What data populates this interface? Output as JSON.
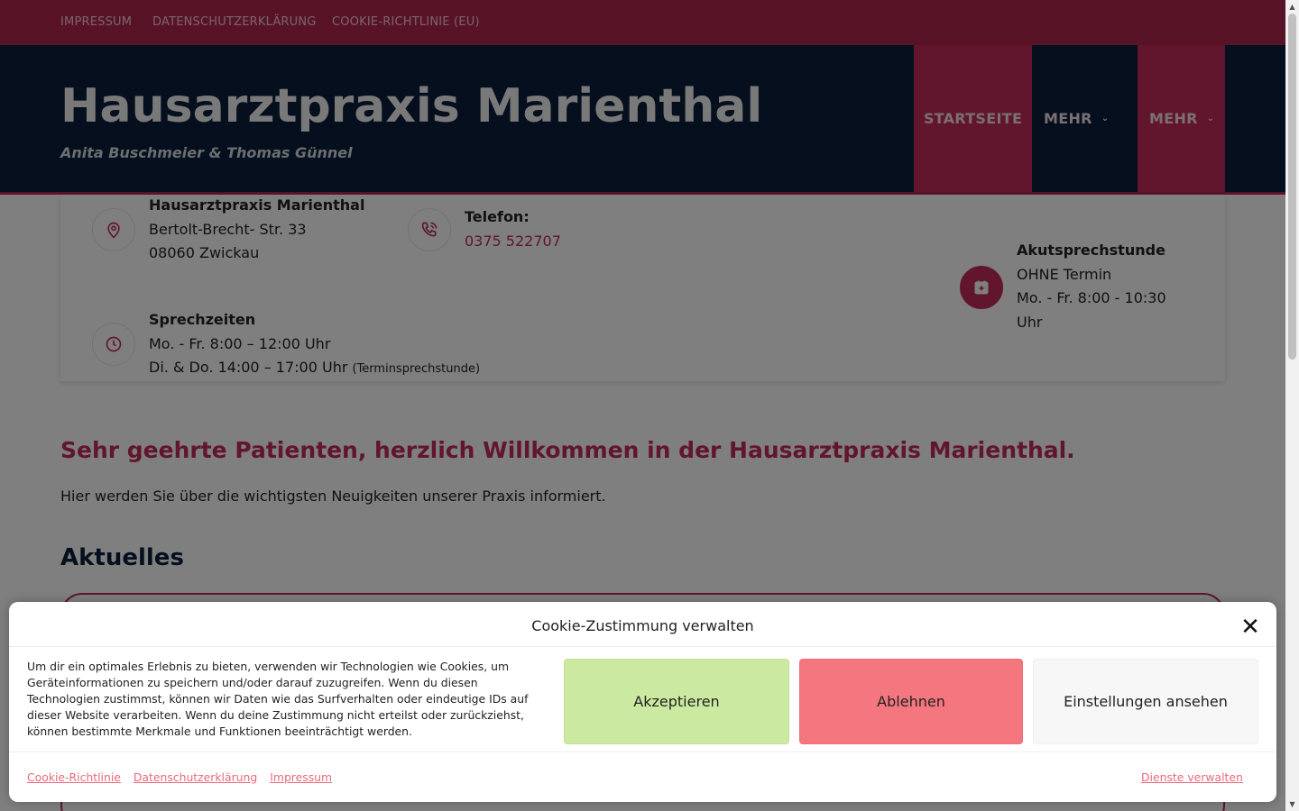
{
  "topbar": {
    "links": [
      "IMPRESSUM",
      "DATENSCHUTZERKLÄRUNG",
      "COOKIE-RICHTLINIE (EU)"
    ]
  },
  "header": {
    "title": "Hausarztpraxis Marienthal",
    "subtitle": "Anita Buschmeier & Thomas Günnel",
    "nav": {
      "home": "STARTSEITE",
      "more1": "MEHR",
      "more2": "MEHR"
    }
  },
  "info": {
    "address": {
      "name": "Hausarztpraxis Marienthal",
      "street": "Bertolt-Brecht- Str. 33",
      "city": "08060 Zwickau",
      "icon": "map-pin-icon"
    },
    "phone": {
      "label": "Telefon:",
      "number": "0375 522707",
      "icon": "phone-icon"
    },
    "hours": {
      "label": "Sprechzeiten",
      "line1": "Mo. - Fr. 8:00 – 12:00 Uhr",
      "line2": "Di. & Do. 14:00 – 17:00 Uhr",
      "line2_note": "(Terminsprechstunde)",
      "icon": "clock-icon"
    },
    "acute": {
      "label": "Akutsprechstunde",
      "line1": "OHNE Termin",
      "line2": "Mo. - Fr. 8:00 - 10:30",
      "line3": "Uhr",
      "icon": "calendar-plus-icon"
    }
  },
  "main": {
    "welcome": "Sehr geehrte Patienten, herzlich Willkommen in der Hausarztpraxis Marienthal.",
    "intro": "Hier werden Sie über die wichtigsten Neuigkeiten unserer Praxis informiert.",
    "news_heading": "Aktuelles"
  },
  "cookie": {
    "title": "Cookie-Zustimmung verwalten",
    "message": "Um dir ein optimales Erlebnis zu bieten, verwenden wir Technologien wie Cookies, um Geräteinformationen zu speichern und/oder darauf zuzugreifen. Wenn du diesen Technologien zustimmst, können wir Daten wie das Surfverhalten oder eindeutige IDs auf dieser Website verarbeiten. Wenn du deine Zustimmung nicht erteilst oder zurückziehst, können bestimmte Merkmale und Funktionen beeinträchtigt werden.",
    "accept": "Akzeptieren",
    "deny": "Ablehnen",
    "settings": "Einstellungen ansehen",
    "links": [
      "Cookie-Richtlinie",
      "Datenschutzerklärung",
      "Impressum"
    ],
    "manage": "Dienste verwalten"
  },
  "colors": {
    "brand": "#c42c5a",
    "navy": "#0b1f3a",
    "accept": "#cbe9a0",
    "deny": "#f4777f"
  }
}
